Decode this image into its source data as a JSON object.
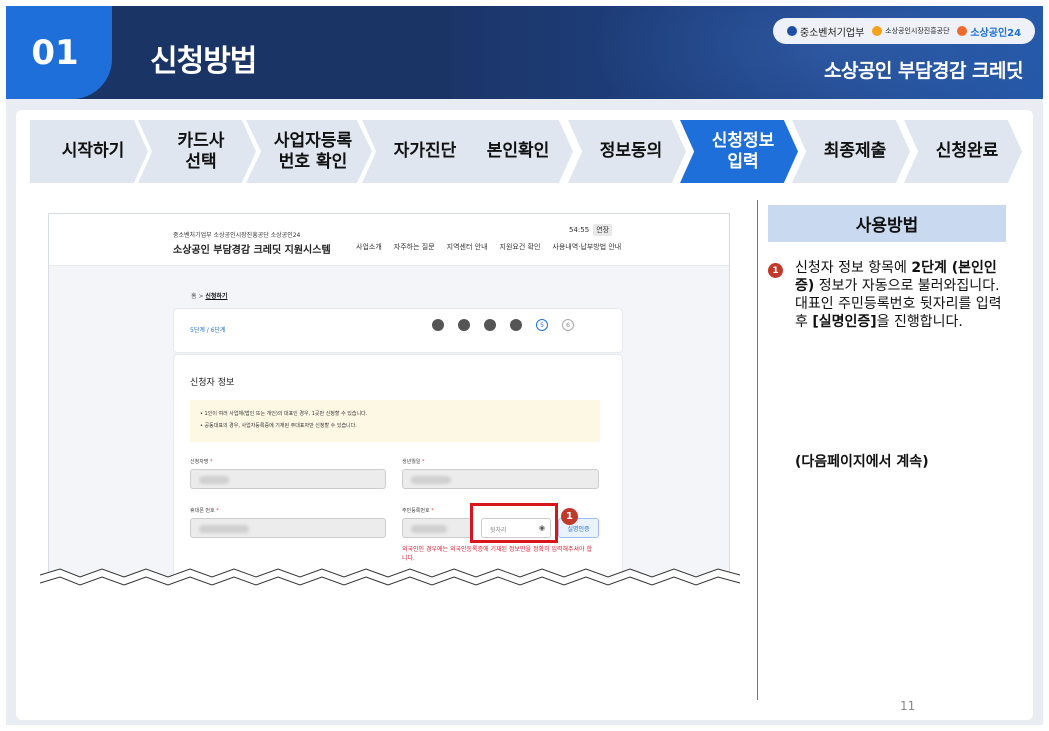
{
  "header": {
    "section_number": "01",
    "title": "신청방법",
    "brand": "소상공인 부담경감 크레딧",
    "logos": [
      "중소벤처기업부",
      "소상공인시장진흥공단",
      "소상공인24"
    ]
  },
  "steps": [
    {
      "label": "시작하기"
    },
    {
      "label": "카드사\n선택"
    },
    {
      "label": "사업자등록\n번호 확인"
    },
    {
      "label": "자가진단"
    },
    {
      "label": "본인확인"
    },
    {
      "label": "정보동의"
    },
    {
      "label": "신청정보\n입력",
      "active": true
    },
    {
      "label": "최종제출"
    },
    {
      "label": "신청완료"
    }
  ],
  "shot": {
    "logos": "중소벤처기업부  소상공인시장진흥공단  소상공인24",
    "site_title": "소상공인 부담경감 크레딧 지원시스템",
    "menu": [
      "사업소개",
      "자주하는 질문",
      "지역센터 안내",
      "지원요건 확인",
      "사용내역·납부방법 안내"
    ],
    "timer": "54:55",
    "extend": "연장",
    "crumb_home": "홈",
    "crumb_current": "신청하기",
    "step_count": "5단계 / 6단계",
    "step_current": "5",
    "step_next": "6",
    "section_title": "신청자 정보",
    "notice1": "• 1인이 여러 사업체(법인 또는 개인)의 대표인 경우, 1곳만 신청할 수 있습니다.",
    "notice2": "• 공동대표의 경우, 사업자등록증에 기재된 주대표자만 신청할 수 있습니다.",
    "label_name": "신청자명",
    "label_birth": "생년월일",
    "label_phone": "휴대폰 번호",
    "label_rrn": "주민등록번호",
    "required": "*",
    "rrn_placeholder": "뒷자리",
    "auth_button": "실명인증",
    "error": "외국인인 경우에는 외국인등록증에 기재된 정보만을 정확히 입력해주셔야 합니다."
  },
  "badge": "1",
  "usage": {
    "title": "사용방법",
    "line1_pre": "신청자 정보 항목에 ",
    "line1_bold": "2단계 (본인인증)",
    "line1_post": " 정보가 자동으로 불러와집니다.",
    "line2_pre": "대표인 주민등록번호 뒷자리를 입력 후 ",
    "line2_bold": "[실명인증]",
    "line2_post": "을 진행합니다.",
    "continue": "(다음페이지에서 계속)"
  },
  "page_number": "11",
  "colors": {
    "navy": "#1b3466",
    "accent": "#1e6fd9",
    "step_bg": "#dfe6ef",
    "highlight": "#d8151b"
  }
}
